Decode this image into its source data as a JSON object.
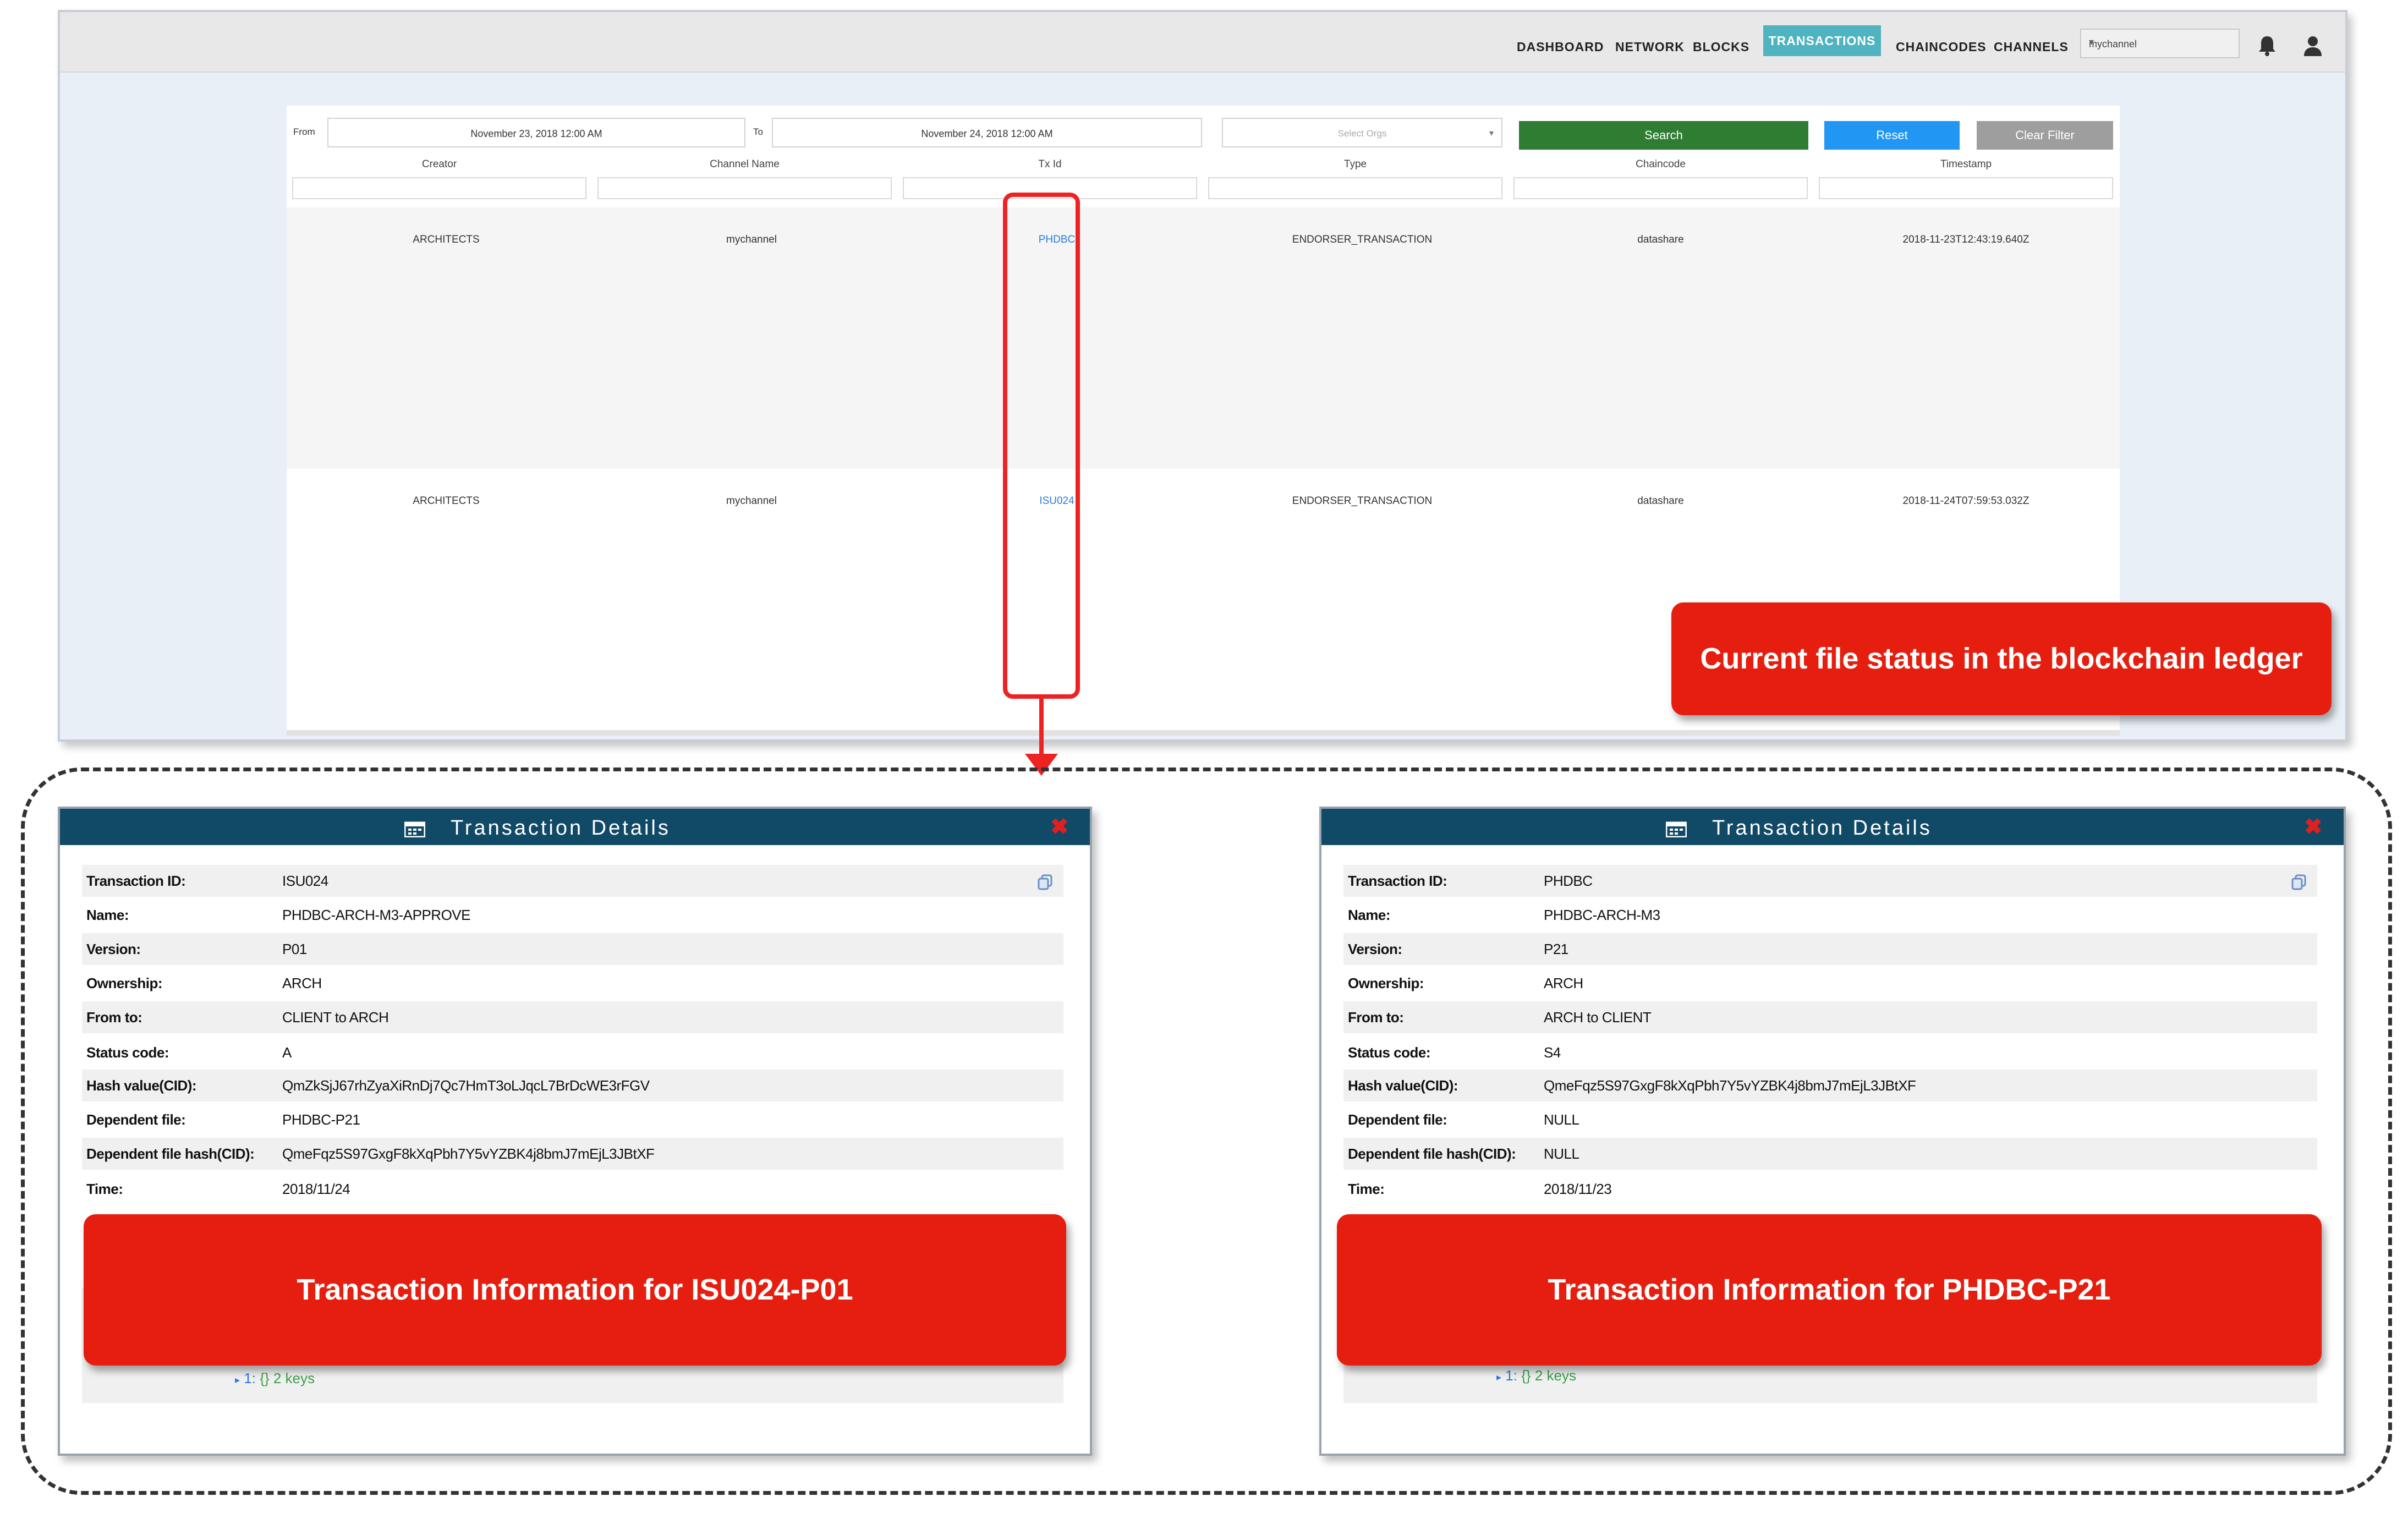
{
  "nav": {
    "items": [
      "DASHBOARD",
      "NETWORK",
      "BLOCKS",
      "TRANSACTIONS",
      "CHAINCODES",
      "CHANNELS"
    ],
    "active": "TRANSACTIONS",
    "channel": "mychannel"
  },
  "filters": {
    "from_label": "From",
    "from_value": "November 23, 2018 12:00 AM",
    "to_label": "To",
    "to_value": "November 24, 2018 12:00 AM",
    "orgs_placeholder": "Select Orgs",
    "search_label": "Search",
    "reset_label": "Reset",
    "clear_label": "Clear Filter"
  },
  "table": {
    "columns": [
      "Creator",
      "Channel Name",
      "Tx Id",
      "Type",
      "Chaincode",
      "Timestamp"
    ],
    "rows": [
      {
        "creator": "ARCHITECTS",
        "channel": "mychannel",
        "txid": "PHDBC",
        "type": "ENDORSER_TRANSACTION",
        "chaincode": "datashare",
        "timestamp": "2018-11-23T12:43:19.640Z"
      },
      {
        "creator": "ARCHITECTS",
        "channel": "mychannel",
        "txid": "ISU024",
        "type": "ENDORSER_TRANSACTION",
        "chaincode": "datashare",
        "timestamp": "2018-11-24T07:59:53.032Z"
      }
    ]
  },
  "callouts": {
    "ledger": "Current file status in the blockchain ledger",
    "left": "Transaction Information for ISU024-P01",
    "right": "Transaction Information for PHDBC-P21"
  },
  "dialogs": [
    {
      "title": "Transaction Details",
      "rows": [
        {
          "key": "Transaction ID:",
          "value": "ISU024"
        },
        {
          "key": "Name:",
          "value": "PHDBC-ARCH-M3-APPROVE"
        },
        {
          "key": "Version:",
          "value": "P01"
        },
        {
          "key": "Ownership:",
          "value": "ARCH"
        },
        {
          "key": "From to:",
          "value": "CLIENT to ARCH"
        },
        {
          "key": "Status code:",
          "value": "A"
        },
        {
          "key": "Hash value(CID):",
          "value": "QmZkSjJ67rhZyaXiRnDj7Qc7HmT3oLJqcL7BrDcWE3rFGV"
        },
        {
          "key": "Dependent file:",
          "value": "PHDBC-P21"
        },
        {
          "key": "Dependent file hash(CID):",
          "value": "QmeFqz5S97GxgF8kXqPbh7Y5vYZBK4j8bmJ7mEjL3JBtXF"
        },
        {
          "key": "Time:",
          "value": "2018/11/24"
        }
      ],
      "json_line": {
        "index": "1:",
        "braces": "{}",
        "keys": "2 keys"
      }
    },
    {
      "title": "Transaction Details",
      "rows": [
        {
          "key": "Transaction ID:",
          "value": "PHDBC"
        },
        {
          "key": "Name:",
          "value": "PHDBC-ARCH-M3"
        },
        {
          "key": "Version:",
          "value": "P21"
        },
        {
          "key": "Ownership:",
          "value": "ARCH"
        },
        {
          "key": "From to:",
          "value": "ARCH to CLIENT"
        },
        {
          "key": "Status code:",
          "value": "S4"
        },
        {
          "key": "Hash value(CID):",
          "value": "QmeFqz5S97GxgF8kXqPbh7Y5vYZBK4j8bmJ7mEjL3JBtXF"
        },
        {
          "key": "Dependent file:",
          "value": "NULL"
        },
        {
          "key": "Dependent file hash(CID):",
          "value": "NULL"
        },
        {
          "key": "Time:",
          "value": "2018/11/23"
        }
      ],
      "json_line": {
        "index": "1:",
        "braces": "{}",
        "keys": "2 keys"
      }
    }
  ],
  "colors": {
    "nav_active": "#4fb3c0",
    "search_button": "#2e7d32",
    "reset_button": "#2196f3",
    "clear_button": "#9e9e9e",
    "callout_red": "#e51e0f",
    "dialog_header": "#114a66",
    "link_blue": "#2a7ae2"
  },
  "icons": [
    "bell-icon",
    "user-icon",
    "calendar-icon",
    "close-icon",
    "copy-icon",
    "chevron-down-icon"
  ]
}
